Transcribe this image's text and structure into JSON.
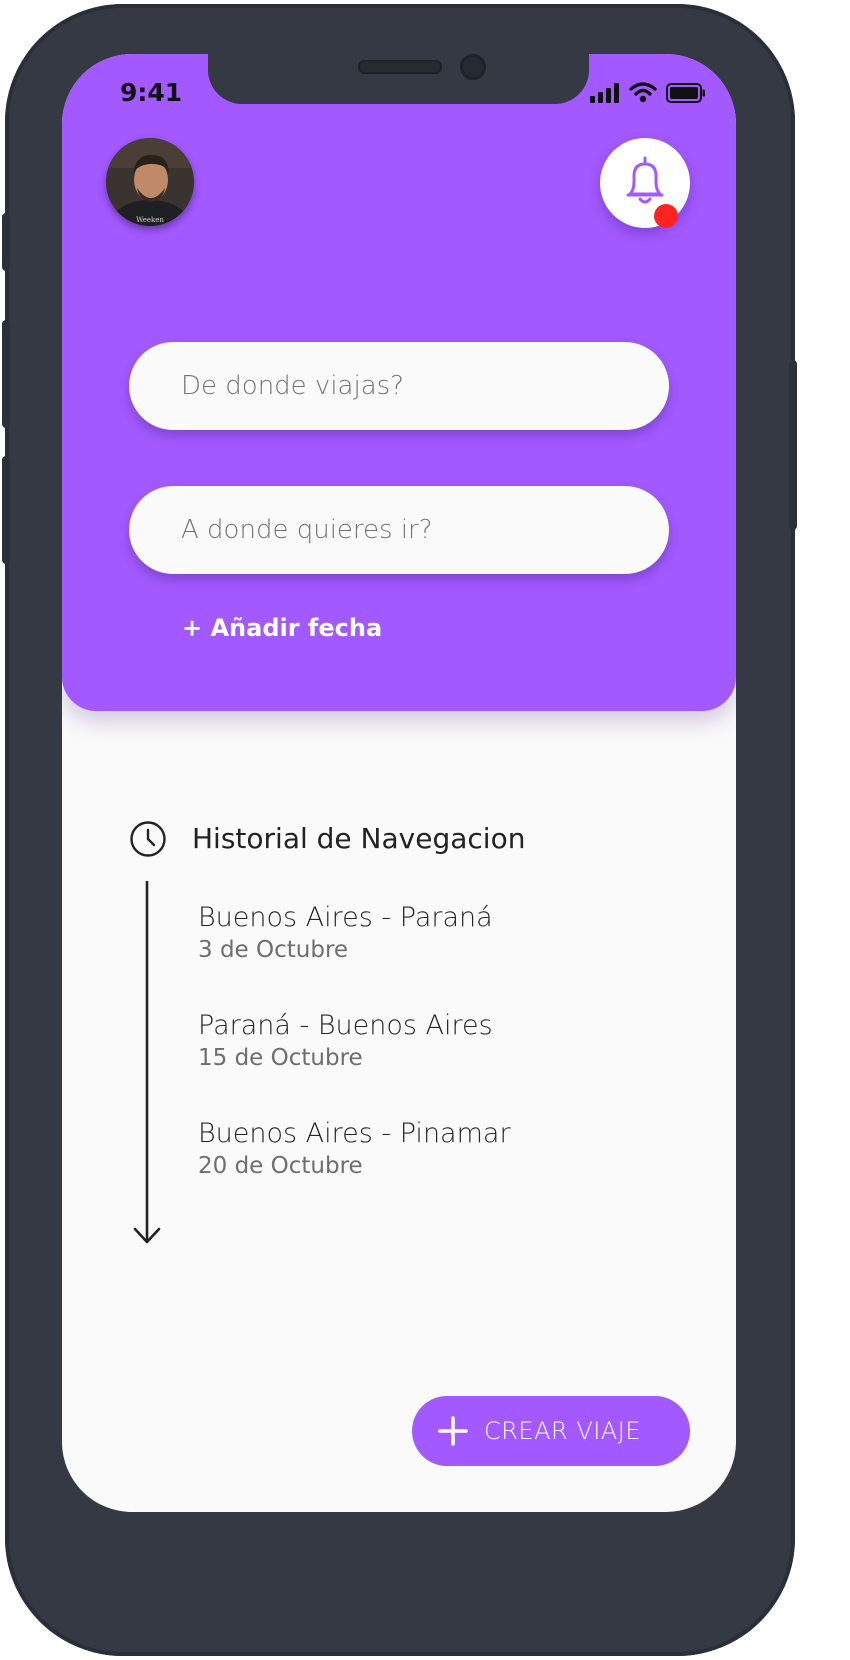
{
  "status_bar": {
    "time": "9:41"
  },
  "header": {
    "origin_field": {
      "placeholder": "De donde viajas?",
      "value": ""
    },
    "destination_field": {
      "placeholder": "A donde quieres ir?",
      "value": ""
    },
    "add_date_label": "+ Añadir fecha",
    "notifications": {
      "has_unread": true
    }
  },
  "history": {
    "title": "Historial de Navegacion",
    "items": [
      {
        "route": "Buenos Aires - Paraná",
        "date": "3 de Octubre"
      },
      {
        "route": "Paraná - Buenos Aires",
        "date": "15 de Octubre"
      },
      {
        "route": "Buenos Aires - Pinamar",
        "date": "20 de Octubre"
      }
    ]
  },
  "create_trip_button": {
    "label": "CREAR VIAJE"
  },
  "colors": {
    "accent": "#a259ff",
    "badge": "#ff2323",
    "device_frame": "#343944",
    "screen_background": "#fafafa"
  },
  "icons": {
    "avatar": "user-photo",
    "bell": "bell-icon",
    "history": "clock-icon",
    "timeline": "arrow-down-icon",
    "create": "plus-icon"
  }
}
